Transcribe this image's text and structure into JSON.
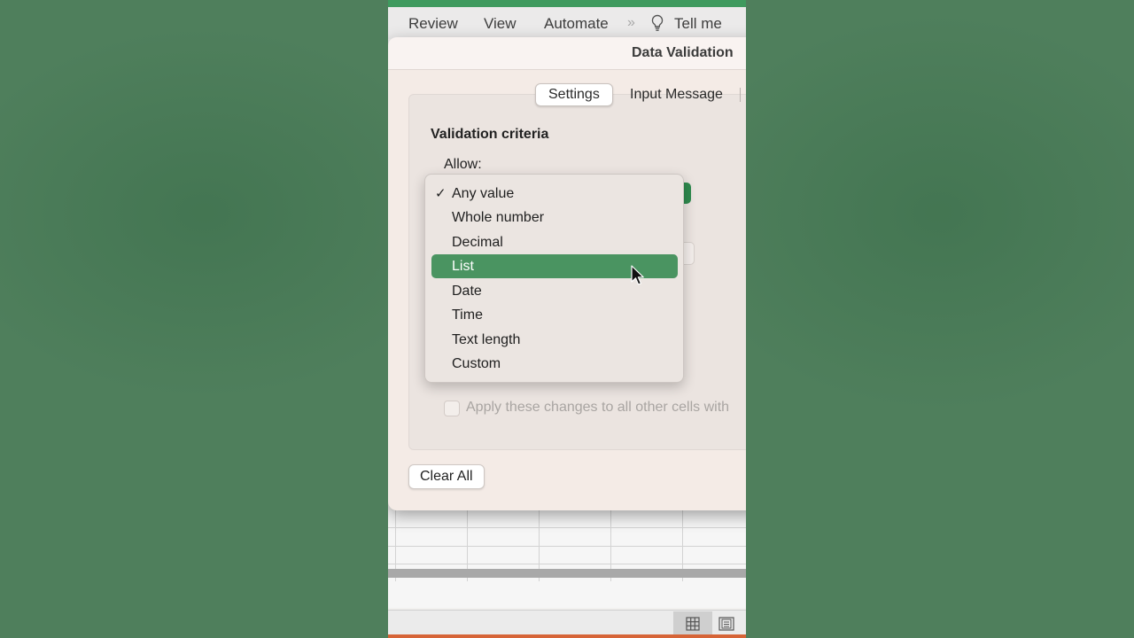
{
  "menubar": {
    "items": [
      "Review",
      "View",
      "Automate"
    ],
    "overflow_icon": "double-chevron-right-icon",
    "tell_me_icon": "lightbulb-icon",
    "tell_me_label": "Tell me"
  },
  "dialog": {
    "title": "Data Validation",
    "tabs": [
      "Settings",
      "Input Message"
    ],
    "selected_tab": "Settings",
    "section_title": "Validation criteria",
    "allow_label": "Allow:",
    "allow_options": [
      "Any value",
      "Whole number",
      "Decimal",
      "List",
      "Date",
      "Time",
      "Text length",
      "Custom"
    ],
    "checked_option": "Any value",
    "highlighted_option": "List",
    "check_glyph": "✓",
    "apply_text": "Apply these changes to all other cells with",
    "clear_all_label": "Clear All"
  },
  "statusbar": {
    "icons": [
      "normal-view-grid-icon",
      "page-layout-view-icon"
    ],
    "active_view": "normal-view-grid-icon"
  },
  "colors": {
    "background": "#4f7f5c",
    "highlight": "#4a9461",
    "accent_top": "#3f9a5e"
  }
}
